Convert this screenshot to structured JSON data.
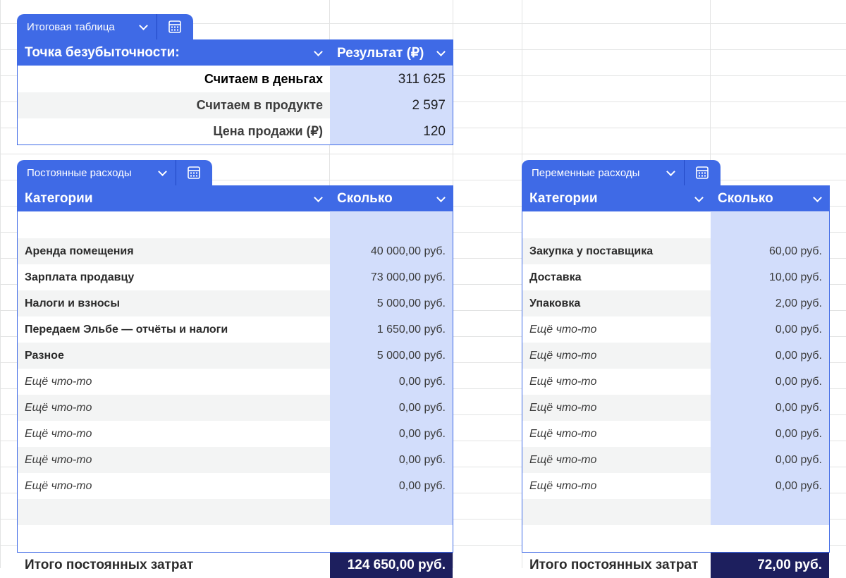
{
  "colors": {
    "accent": "#3f6ae6",
    "cell_highlight": "#d2ddfb",
    "total_bg": "#1d1f5e"
  },
  "summary": {
    "tab_label": "Итоговая таблица",
    "header": {
      "col1": "Точка безубыточности:",
      "col2": "Результат (₽)"
    },
    "rows": [
      {
        "label": "Считаем в деньгах",
        "value": "311 625"
      },
      {
        "label": "Считаем в продукте",
        "value": "2 597"
      },
      {
        "label": "Цена продажи (₽)",
        "value": "120"
      }
    ]
  },
  "fixed": {
    "tab_label": "Постоянные расходы",
    "header": {
      "col1": "Категории",
      "col2": "Сколько"
    },
    "rows": [
      {
        "label": "",
        "value": ""
      },
      {
        "label": "Аренда помещения",
        "value": "40 000,00 руб."
      },
      {
        "label": "Зарплата продавцу",
        "value": "73 000,00 руб."
      },
      {
        "label": "Налоги и взносы",
        "value": "5 000,00 руб."
      },
      {
        "label": "Передаем Эльбе — отчёты и налоги",
        "value": "1 650,00 руб."
      },
      {
        "label": "Разное",
        "value": "5 000,00 руб."
      },
      {
        "label": "Ещё что-то",
        "value": "0,00 руб."
      },
      {
        "label": "Ещё что-то",
        "value": "0,00 руб."
      },
      {
        "label": "Ещё что-то",
        "value": "0,00 руб."
      },
      {
        "label": "Ещё что-то",
        "value": "0,00 руб."
      },
      {
        "label": "Ещё что-то",
        "value": "0,00 руб."
      },
      {
        "label": "",
        "value": ""
      }
    ],
    "total": {
      "label": "Итого постоянных затрат",
      "value": "124 650,00 руб."
    }
  },
  "variable": {
    "tab_label": "Переменные расходы",
    "header": {
      "col1": "Категории",
      "col2": "Сколько"
    },
    "rows": [
      {
        "label": "",
        "value": ""
      },
      {
        "label": "Закупка у поставщика",
        "value": "60,00 руб."
      },
      {
        "label": "Доставка",
        "value": "10,00 руб."
      },
      {
        "label": "Упаковка",
        "value": "2,00 руб."
      },
      {
        "label": "Ещё что-то",
        "value": "0,00 руб."
      },
      {
        "label": "Ещё что-то",
        "value": "0,00 руб."
      },
      {
        "label": "Ещё что-то",
        "value": "0,00 руб."
      },
      {
        "label": "Ещё что-то",
        "value": "0,00 руб."
      },
      {
        "label": "Ещё что-то",
        "value": "0,00 руб."
      },
      {
        "label": "Ещё что-то",
        "value": "0,00 руб."
      },
      {
        "label": "Ещё что-то",
        "value": "0,00 руб."
      },
      {
        "label": "",
        "value": ""
      }
    ],
    "total": {
      "label": "Итого постоянных затрат",
      "value": "72,00 руб."
    }
  }
}
